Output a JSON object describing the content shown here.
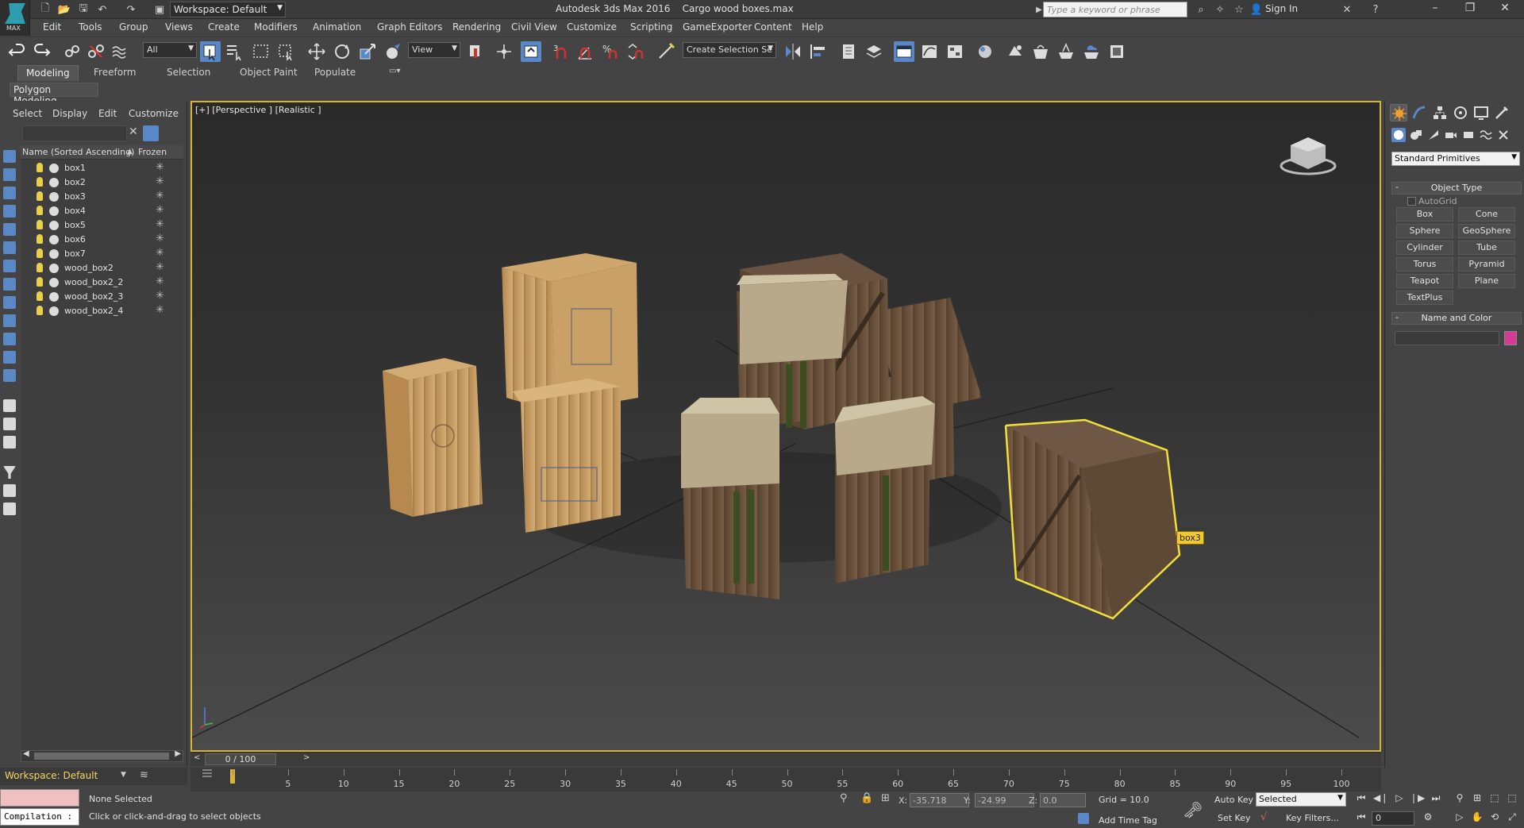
{
  "titlebar": {
    "workspace": "Workspace: Default",
    "app_title": "Autodesk 3ds Max 2016",
    "file_name": "Cargo wood boxes.max",
    "search_placeholder": "Type a keyword or phrase",
    "sign_in": "Sign In",
    "logo_text": "MAX"
  },
  "menu": [
    "Edit",
    "Tools",
    "Group",
    "Views",
    "Create",
    "Modifiers",
    "Animation",
    "Graph Editors",
    "Rendering",
    "Civil View",
    "Customize",
    "Scripting",
    "GameExporter",
    "Content",
    "Help"
  ],
  "toolbar": {
    "selection_filter": "All",
    "ref_coord": "View",
    "selection_set": "Create Selection Se"
  },
  "ribbon": {
    "tabs": [
      "Modeling",
      "Freeform",
      "Selection",
      "Object Paint",
      "Populate"
    ],
    "sub_label": "Polygon Modeling"
  },
  "explorer": {
    "menu": [
      "Select",
      "Display",
      "Edit",
      "Customize"
    ],
    "col_name": "Name (Sorted Ascending)",
    "col_frozen": "Frozen",
    "items": [
      "box1",
      "box2",
      "box3",
      "box4",
      "box5",
      "box6",
      "box7",
      "wood_box2",
      "wood_box2_2",
      "wood_box2_3",
      "wood_box2_4"
    ]
  },
  "viewport": {
    "label": "[+] [Perspective ] [Realistic ]",
    "selected_tag": "box3"
  },
  "timeline": {
    "slider": "0 / 100",
    "ticks": [
      "5",
      "10",
      "15",
      "20",
      "25",
      "30",
      "35",
      "40",
      "45",
      "50",
      "55",
      "60",
      "65",
      "70",
      "75",
      "80",
      "85",
      "90",
      "95",
      "100"
    ]
  },
  "bottom": {
    "workspace": "Workspace: Default",
    "compilation": "Compilation :",
    "status1": "None Selected",
    "status2": "Click or click-and-drag to select objects",
    "x_label": "X:",
    "x_value": "-35.718",
    "y_label": "Y:",
    "y_value": "-24.99",
    "z_label": "Z:",
    "z_value": "0.0",
    "grid": "Grid = 10.0",
    "add_time_tag": "Add Time Tag",
    "auto_key": "Auto Key",
    "set_key": "Set Key",
    "selected": "Selected",
    "key_filters": "Key Filters...",
    "frame": "0"
  },
  "command_panel": {
    "category": "Standard Primitives",
    "object_type_header": "Object Type",
    "autogrid": "AutoGrid",
    "primitives": [
      "Box",
      "Cone",
      "Sphere",
      "GeoSphere",
      "Cylinder",
      "Tube",
      "Torus",
      "Pyramid",
      "Teapot",
      "Plane",
      "TextPlus"
    ],
    "name_color_header": "Name and Color",
    "swatch_color": "#d23c96"
  }
}
